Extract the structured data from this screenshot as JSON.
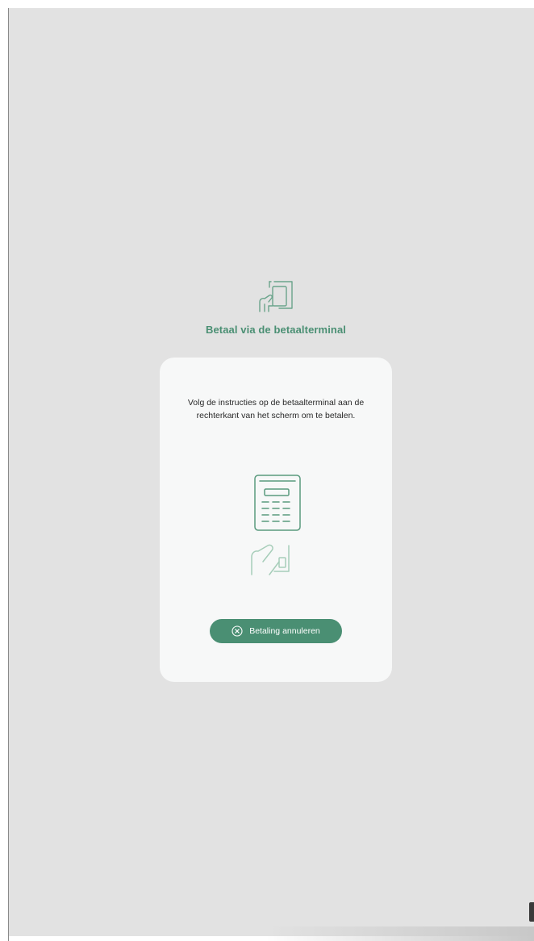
{
  "header": {
    "icon": "tap-card-icon",
    "title": "Betaal via de betaalterminal"
  },
  "card": {
    "instruction": "Volg de instructies op de betaalterminal aan de rechterkant van het scherm om te betalen.",
    "illustration": "payment-terminal-icon",
    "cancel_button": {
      "label": "Betaling annuleren",
      "icon": "close-circle-icon"
    }
  },
  "colors": {
    "accent": "#4a8f73",
    "background": "#e2e2e2",
    "card": "#f7f8f8"
  }
}
